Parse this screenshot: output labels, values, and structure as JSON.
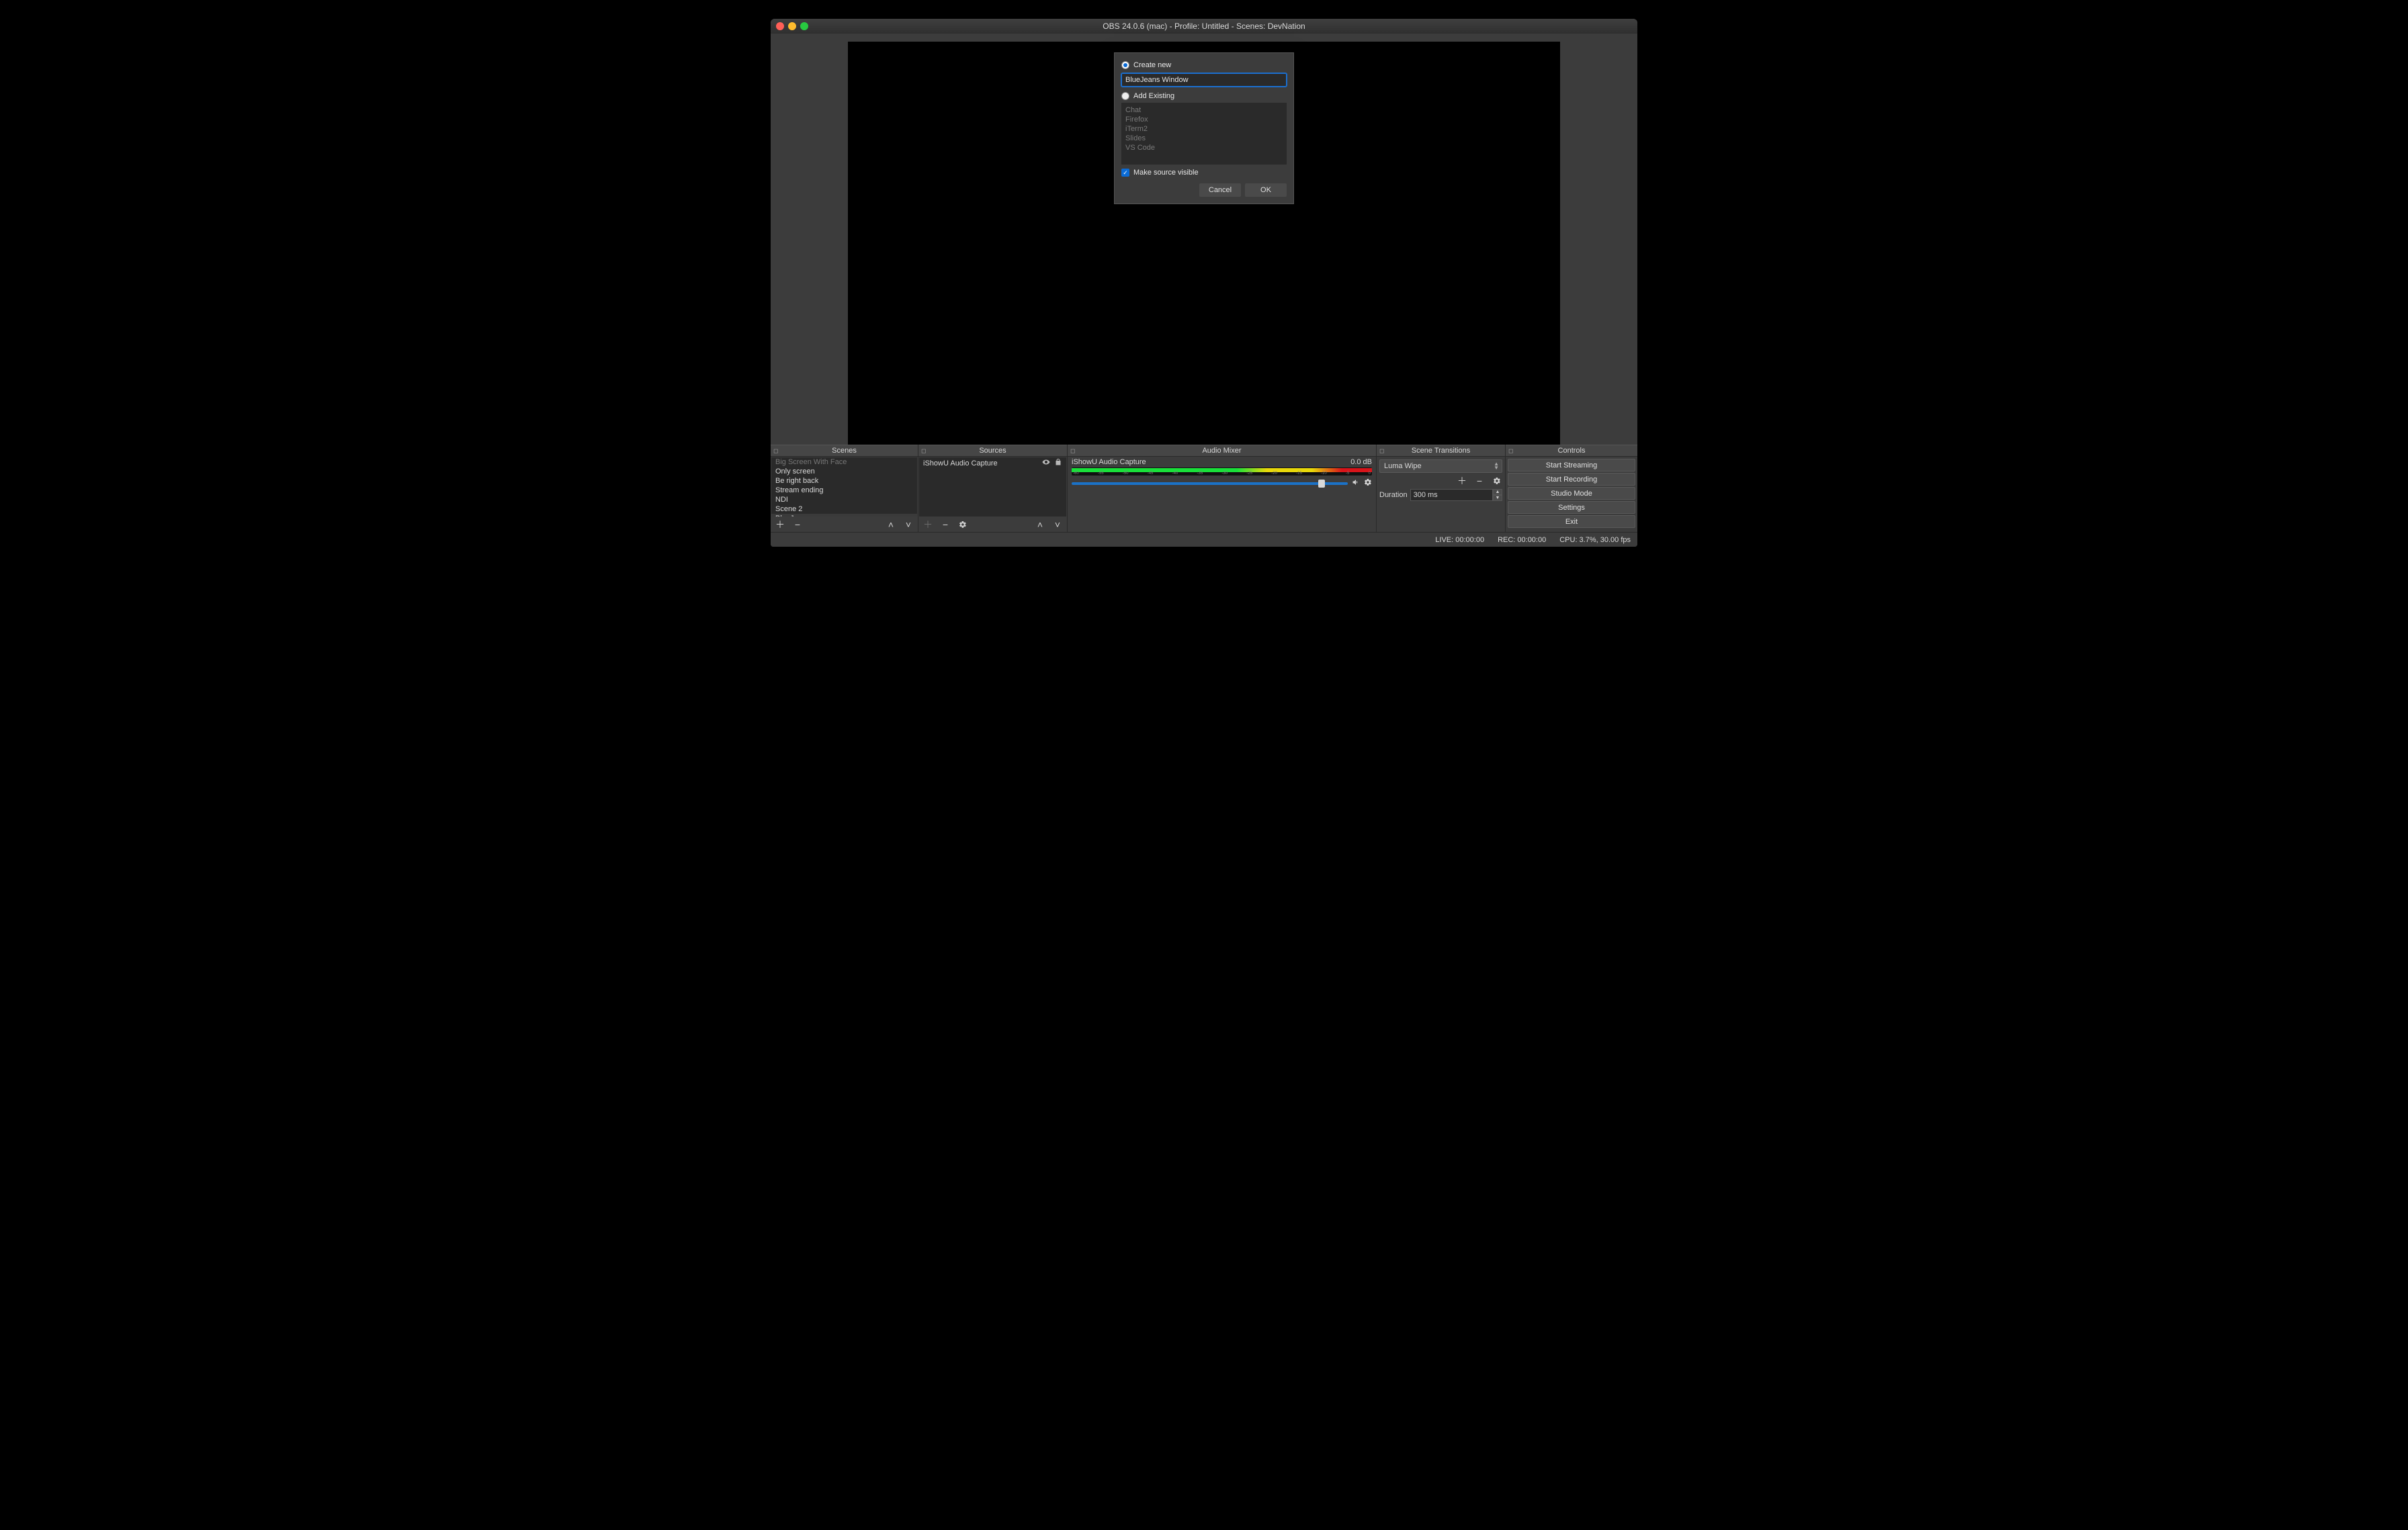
{
  "window_title": "OBS 24.0.6 (mac) - Profile: Untitled - Scenes: DevNation",
  "docks": {
    "scenes_header": "Scenes",
    "sources_header": "Sources",
    "mixer_header": "Audio Mixer",
    "transitions_header": "Scene Transitions",
    "controls_header": "Controls"
  },
  "scenes": {
    "items": [
      {
        "label": "Big Screen With Face",
        "cut": true
      },
      {
        "label": "Only screen"
      },
      {
        "label": "Be right back"
      },
      {
        "label": "Stream ending"
      },
      {
        "label": "NDI"
      },
      {
        "label": "Scene 2"
      },
      {
        "label": "BlueJeans",
        "selected": true
      }
    ]
  },
  "sources": {
    "items": [
      {
        "label": "iShowU Audio Capture"
      }
    ]
  },
  "mixer": {
    "channel_name": "iShowU Audio Capture",
    "channel_level": "0.0 dB",
    "ticks": [
      "-60",
      "-55",
      "-50",
      "-45",
      "-40",
      "-35",
      "-30",
      "-25",
      "-20",
      "-15",
      "-10",
      "-5",
      "0"
    ]
  },
  "transitions": {
    "selected": "Luma Wipe",
    "duration_label": "Duration",
    "duration_value": "300 ms"
  },
  "controls": {
    "start_streaming": "Start Streaming",
    "start_recording": "Start Recording",
    "studio_mode": "Studio Mode",
    "settings": "Settings",
    "exit": "Exit"
  },
  "status": {
    "live": "LIVE: 00:00:00",
    "rec": "REC: 00:00:00",
    "cpu": "CPU: 3.7%, 30.00 fps"
  },
  "dialog": {
    "create_new_label": "Create new",
    "name_value": "BlueJeans Window",
    "add_existing_label": "Add Existing",
    "existing": [
      "Chat",
      "Firefox",
      "iTerm2",
      "Slides",
      "VS Code"
    ],
    "make_visible_label": "Make source visible",
    "cancel": "Cancel",
    "ok": "OK"
  }
}
